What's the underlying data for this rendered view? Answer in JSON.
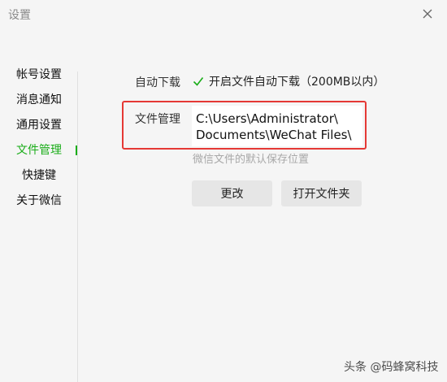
{
  "window": {
    "title": "设置"
  },
  "sidebar": {
    "items": [
      {
        "label": "帐号设置",
        "active": false
      },
      {
        "label": "消息通知",
        "active": false
      },
      {
        "label": "通用设置",
        "active": false
      },
      {
        "label": "文件管理",
        "active": true
      },
      {
        "label": "快捷键",
        "active": false
      },
      {
        "label": "关于微信",
        "active": false
      }
    ]
  },
  "auto_download": {
    "label": "自动下载",
    "checkbox_label": "开启文件自动下载（200MB以内）",
    "checked": true
  },
  "file_management": {
    "label": "文件管理",
    "path_line1": "C:\\Users\\Administrator\\",
    "path_line2": "Documents\\WeChat Files\\",
    "hint": "微信文件的默认保存位置"
  },
  "buttons": {
    "change": "更改",
    "open_folder": "打开文件夹"
  },
  "watermark": "头条 @码蜂窝科技",
  "colors": {
    "accent": "#1aad19",
    "highlight_border": "#e53935",
    "background": "#f5f5f5"
  }
}
